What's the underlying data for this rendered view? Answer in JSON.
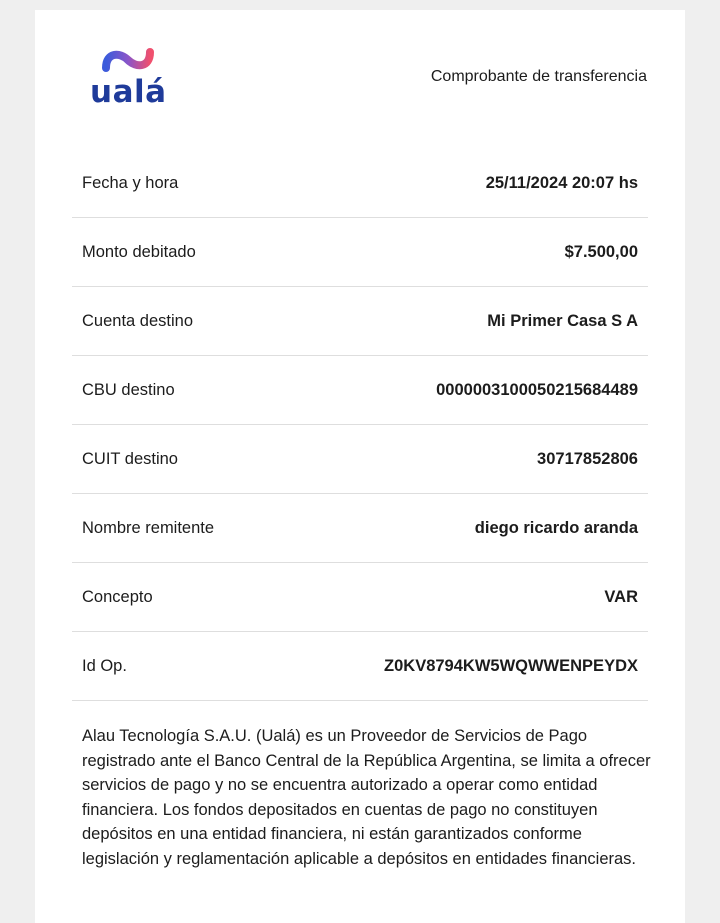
{
  "header": {
    "logo_text": "ualá",
    "title": "Comprobante de transferencia"
  },
  "brand_colors": {
    "navy": "#1f3b9a",
    "pink": "#f0506e",
    "blue": "#3b5bdb"
  },
  "fields": [
    {
      "label": "Fecha y hora",
      "value": "25/11/2024 20:07 hs"
    },
    {
      "label": "Monto debitado",
      "value": "$7.500,00"
    },
    {
      "label": "Cuenta destino",
      "value": "Mi Primer Casa S A"
    },
    {
      "label": "CBU destino",
      "value": "0000003100050215684489"
    },
    {
      "label": "CUIT destino",
      "value": "30717852806"
    },
    {
      "label": "Nombre remitente",
      "value": "diego ricardo aranda"
    },
    {
      "label": "Concepto",
      "value": "VAR"
    },
    {
      "label": "Id Op.",
      "value": "Z0KV8794KW5WQWWENPEYDX"
    }
  ],
  "disclaimer": "Alau Tecnología S.A.U. (Ualá) es un Proveedor de Servicios de Pago registrado ante el Banco Central de la República Argentina, se limita a ofrecer servicios de pago y no se encuentra autorizado a operar como entidad financiera. Los fondos depositados en cuentas de pago no constituyen depósitos en una entidad financiera, ni están garantizados conforme legislación y reglamentación aplicable a depósitos en entidades financieras."
}
